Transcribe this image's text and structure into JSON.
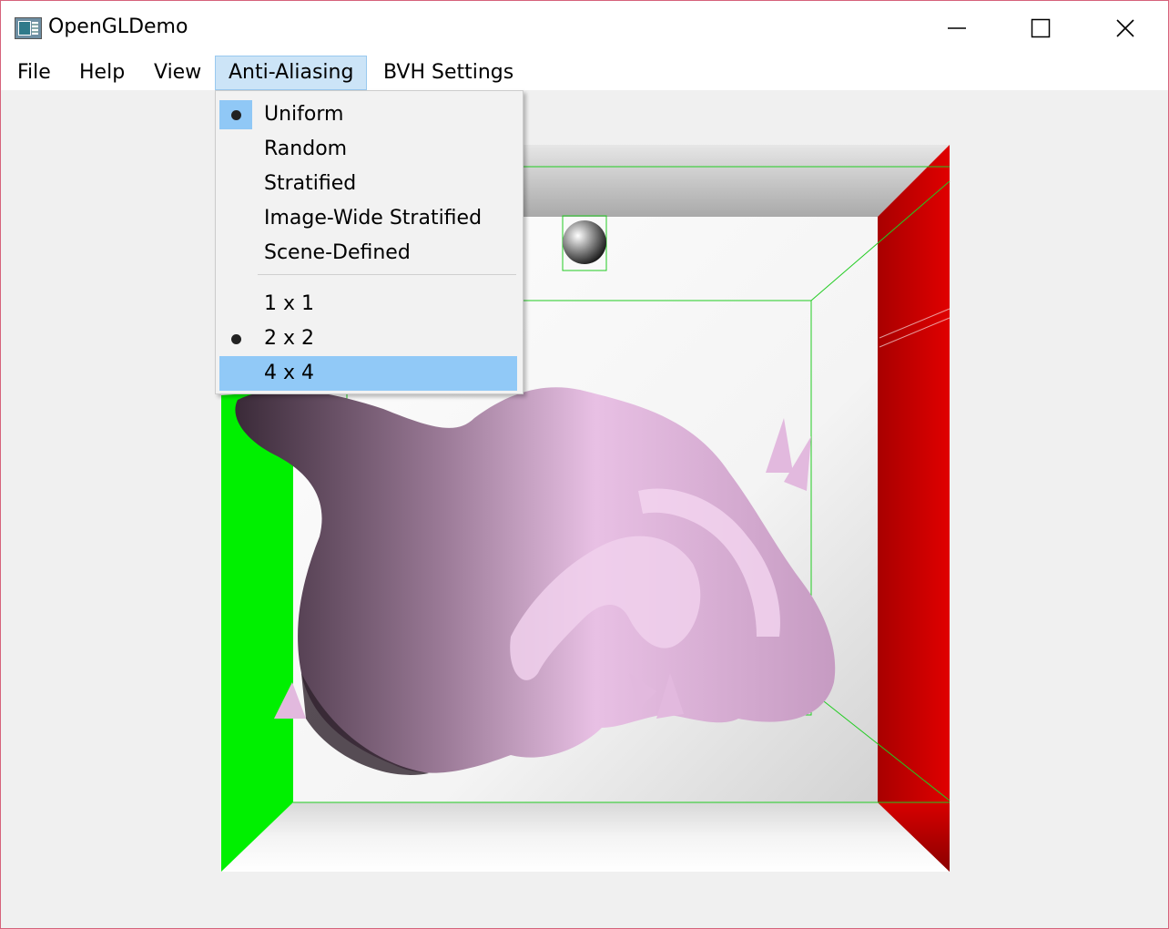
{
  "window": {
    "title": "OpenGLDemo",
    "controls": {
      "minimize": "minimize-icon",
      "maximize": "maximize-icon",
      "close": "close-icon"
    }
  },
  "menubar": {
    "items": [
      {
        "label": "File"
      },
      {
        "label": "Help"
      },
      {
        "label": "View"
      },
      {
        "label": "Anti-Aliasing",
        "active": true
      },
      {
        "label": "BVH Settings"
      }
    ]
  },
  "anti_aliasing_menu": {
    "sampling_modes": [
      {
        "label": "Uniform",
        "checked": true
      },
      {
        "label": "Random",
        "checked": false
      },
      {
        "label": "Stratified",
        "checked": false
      },
      {
        "label": "Image-Wide Stratified",
        "checked": false
      },
      {
        "label": "Scene-Defined",
        "checked": false
      }
    ],
    "grid_sizes": [
      {
        "label": "1 x 1",
        "checked": false
      },
      {
        "label": "2 x 2",
        "checked": true
      },
      {
        "label": "4 x 4",
        "checked": false,
        "hovered": true
      }
    ]
  },
  "scene": {
    "description_icon": "rendered-cornell-box-with-dragon",
    "colors": {
      "left_wall": "#00f000",
      "right_wall": "#d00000",
      "dragon": "#e9c2e5",
      "bvh_lines": "#22cc22",
      "highlight": "#91c9f7",
      "menu_active_bg": "#cce4f7",
      "window_border": "#d6627b"
    }
  }
}
